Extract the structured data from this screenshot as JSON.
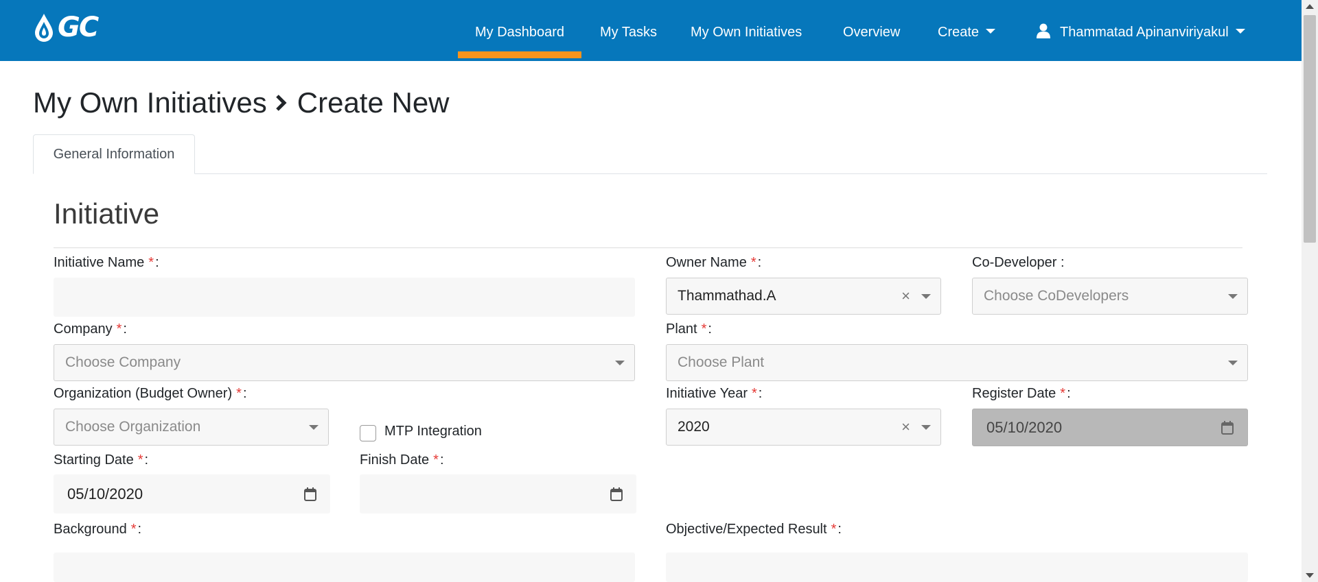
{
  "nav": {
    "logo_text": "GC",
    "items": [
      {
        "label": "My Dashboard",
        "active": true
      },
      {
        "label": "My Tasks"
      },
      {
        "label": "My Own Initiatives"
      },
      {
        "label": "Overview"
      },
      {
        "label": "Create"
      }
    ],
    "user_name": "Thammatad Apinanviriyakul"
  },
  "breadcrumb": {
    "parent": "My Own Initiatives",
    "current": "Create New"
  },
  "tabs": [
    {
      "label": "General Information",
      "active": true
    }
  ],
  "section_title": "Initiative",
  "form": {
    "initiative_name": {
      "label": "Initiative Name",
      "value": ""
    },
    "owner_name": {
      "label": "Owner Name",
      "value": "Thammathad.A"
    },
    "co_developer": {
      "label": "Co-Developer :",
      "placeholder": "Choose CoDevelopers"
    },
    "company": {
      "label": "Company",
      "placeholder": "Choose Company"
    },
    "plant": {
      "label": "Plant",
      "placeholder": "Choose Plant"
    },
    "organization": {
      "label": "Organization (Budget Owner)",
      "placeholder": "Choose Organization"
    },
    "mtp_integration": {
      "label": "MTP Integration",
      "checked": false
    },
    "initiative_year": {
      "label": "Initiative Year",
      "value": "2020"
    },
    "register_date": {
      "label": "Register Date",
      "value": "05/10/2020"
    },
    "starting_date": {
      "label": "Starting Date",
      "value": "05/10/2020"
    },
    "finish_date": {
      "label": "Finish Date",
      "value": ""
    },
    "background": {
      "label": "Background",
      "value": ""
    },
    "objective": {
      "label": "Objective/Expected Result",
      "value": ""
    }
  },
  "required_mark": "*",
  "label_suffix": ":",
  "colors": {
    "navbar": "#0677bb",
    "active_underline": "#f7941d",
    "required": "#e53935"
  }
}
